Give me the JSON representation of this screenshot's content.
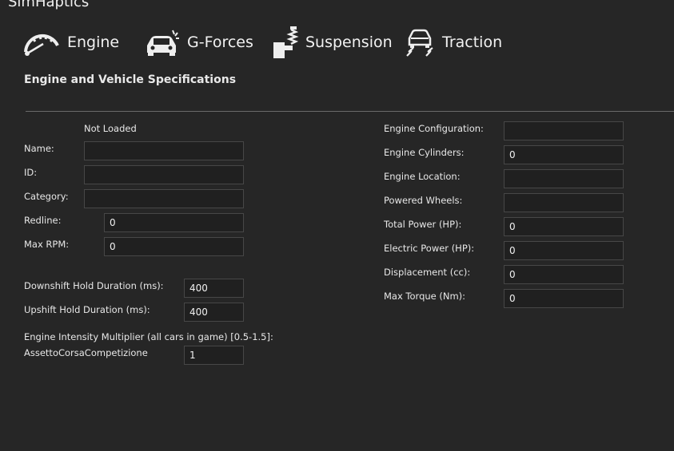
{
  "app": {
    "title": "SimHaptics"
  },
  "tabs": [
    {
      "label": "Engine",
      "icon": "speedometer-icon"
    },
    {
      "label": "G-Forces",
      "icon": "car-crash-icon"
    },
    {
      "label": "Suspension",
      "icon": "suspension-icon"
    },
    {
      "label": "Traction",
      "icon": "traction-skid-icon"
    }
  ],
  "section": {
    "title": "Engine and Vehicle Specifications"
  },
  "left": {
    "status": "Not Loaded",
    "name_label": "Name:",
    "name_value": "",
    "id_label": "ID:",
    "id_value": "",
    "category_label": "Category:",
    "category_value": "",
    "redline_label": "Redline:",
    "redline_value": "0",
    "maxrpm_label": "Max RPM:",
    "maxrpm_value": "0",
    "downshift_label": "Downshift Hold Duration (ms):",
    "downshift_value": "400",
    "upshift_label": "Upshift Hold Duration (ms):",
    "upshift_value": "400",
    "intensity_label": "Engine Intensity Multiplier (all cars in game) [0.5-1.5]:",
    "game_label": "AssettoCorsaCompetizione",
    "intensity_value": "1"
  },
  "right": {
    "config_label": "Engine Configuration:",
    "config_value": "",
    "cylinders_label": "Engine Cylinders:",
    "cylinders_value": "0",
    "location_label": "Engine Location:",
    "location_value": "",
    "wheels_label": "Powered Wheels:",
    "wheels_value": "",
    "power_label": "Total Power (HP):",
    "power_value": "0",
    "electric_label": "Electric Power (HP):",
    "electric_value": "0",
    "displacement_label": "Displacement (cc):",
    "displacement_value": "0",
    "torque_label": "Max Torque (Nm):",
    "torque_value": "0"
  }
}
